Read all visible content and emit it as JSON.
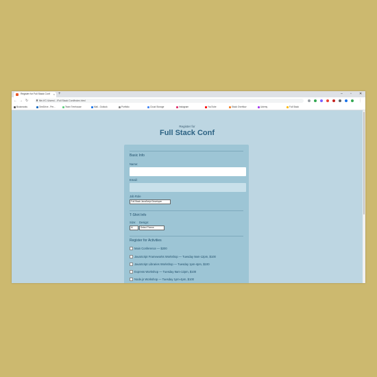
{
  "browser": {
    "tab_title": "Register for Full Stack Conf",
    "new_tab_symbol": "+",
    "window_controls": [
      "–",
      "▫",
      "✕"
    ],
    "url": "file:///C:/Users/.../Full Stack Conf/index.html",
    "bookmarks": [
      "Bookmarks",
      "OneDrive - Per...",
      "Team Treehouse",
      "Mail - Outlook",
      "Portfolio",
      "Cloud Storage",
      "Instagram",
      "YouTube",
      "Stack Overflow",
      "Udemy",
      "Full Stack"
    ]
  },
  "header": {
    "kicker": "Register for",
    "title": "Full Stack Conf"
  },
  "form": {
    "basic_info": {
      "legend": "Basic Info",
      "name_label": "Name:",
      "name_value": "",
      "email_label": "Email:",
      "email_value": "",
      "job_role_label": "Job Role",
      "job_role_value": "Full Stack JavaScript Developer"
    },
    "tshirt": {
      "legend": "T-Shirt Info",
      "size_label": "Size:",
      "size_value": "M",
      "design_label": "Design:",
      "design_value": "Select Theme"
    },
    "activities": {
      "legend": "Register for Activities",
      "items": [
        "Main Conference — $200",
        "JavaScript Frameworks Workshop — Tuesday 9am-12pm, $100",
        "JavaScript Libraries Workshop — Tuesday 1pm-4pm, $100",
        "Express Workshop — Tuesday 9am-12pm, $100",
        "Node.js Workshop — Tuesday 1pm-4pm, $100"
      ]
    }
  },
  "colors": {
    "background": "#ccb96f",
    "page": "#bdd6e2",
    "form_panel": "#9dc5d5",
    "title": "#2c6283"
  }
}
